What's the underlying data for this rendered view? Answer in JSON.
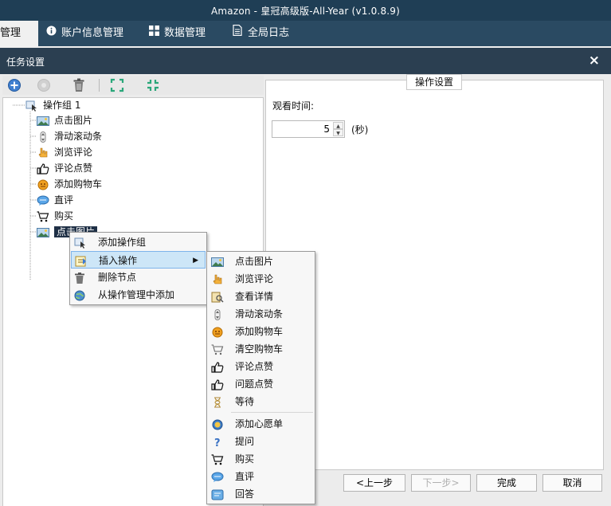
{
  "window": {
    "title": "Amazon - 皇冠高级版-All-Year  (v1.0.8.9)"
  },
  "nav": {
    "items": [
      {
        "label": "管理",
        "icon": "none"
      },
      {
        "label": "账户信息管理",
        "icon": "info-icon"
      },
      {
        "label": "数据管理",
        "icon": "grid-icon"
      },
      {
        "label": "全局日志",
        "icon": "document-icon"
      }
    ]
  },
  "dialog": {
    "title": "任务设置",
    "close": "×",
    "toolbar": [
      "add-icon",
      "disabled-icon",
      "trash-icon",
      "expand-icon",
      "collapse-icon"
    ],
    "tree": {
      "root": "操作组 1",
      "children": [
        "点击图片",
        "滑动滚动条",
        "浏览评论",
        "评论点赞",
        "添加购物车",
        "直评",
        "购买",
        "点击图片"
      ],
      "selected_index": 7
    },
    "settings": {
      "caption": "操作设置",
      "watch_label": "观看时间:",
      "watch_value": "5",
      "unit": "(秒)"
    },
    "buttons": {
      "prev": "<上一步",
      "next": "下一步>",
      "finish": "完成",
      "cancel": "取消"
    }
  },
  "context_menu": {
    "items": [
      "添加操作组",
      "插入操作",
      "删除节点",
      "从操作管理中添加"
    ],
    "highlighted_index": 1
  },
  "submenu": {
    "items": [
      "点击图片",
      "浏览评论",
      "查看详情",
      "滑动滚动条",
      "添加购物车",
      "清空购物车",
      "评论点赞",
      "问题点赞",
      "等待",
      "添加心愿单",
      "提问",
      "购买",
      "直评",
      "回答"
    ]
  },
  "colors": {
    "titlebar": "#1f3e55",
    "navbar": "#2a4a62",
    "dialog_header": "#2b3f51",
    "selection": "#1f3046",
    "menu_highlight": "#cde6f7"
  }
}
